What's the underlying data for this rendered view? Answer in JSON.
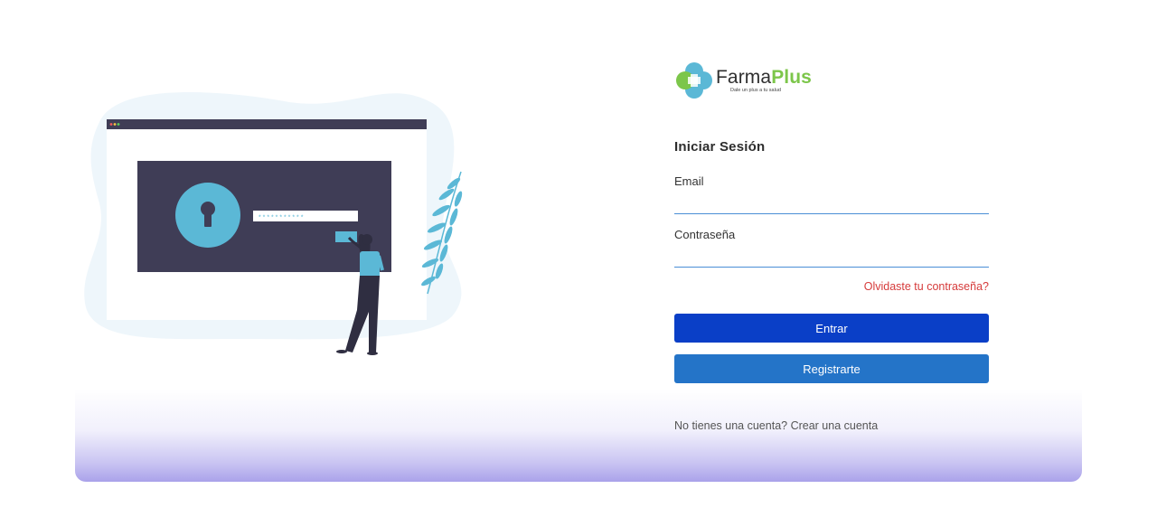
{
  "brand": {
    "name_part1": "Farma",
    "name_part2": "Plus",
    "tagline": "Dale un plus a tu salud"
  },
  "login": {
    "title": "Iniciar Sesión",
    "email_label": "Email",
    "email_value": "",
    "password_label": "Contraseña",
    "password_value": "",
    "forgot_link": "Olvidaste tu contraseña?",
    "submit_button": "Entrar",
    "register_button": "Registrarte",
    "signup_prompt": "No tienes una cuenta?",
    "signup_link": "Crear una cuenta"
  },
  "illustration": {
    "password_mask": "* * * * * * * * * * *"
  },
  "colors": {
    "primary_button": "#0a3fc7",
    "secondary_button": "#2474c8",
    "forgot_link": "#d63b3b",
    "brand_green": "#7cc64a",
    "field_underline": "#4a8fd6",
    "illustration_accent": "#5bb8d6"
  }
}
